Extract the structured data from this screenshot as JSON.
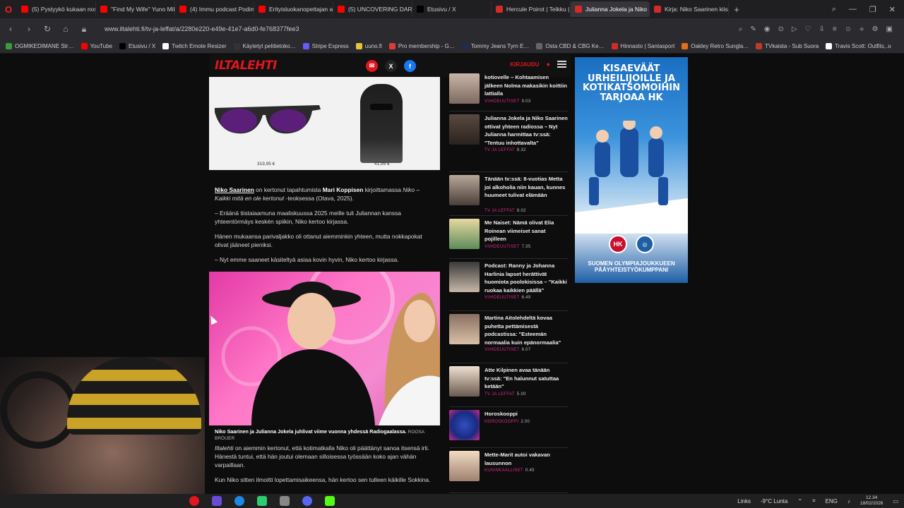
{
  "browser": {
    "tabs": [
      {
        "title": "(5) Pystyykö kukaan nostamaan…",
        "color": "#ff0000"
      },
      {
        "title": "\"Find My Wife\" Yuno Miles…",
        "color": "#ff0000"
      },
      {
        "title": "(4) Immu podcast Podimo…",
        "color": "#ff0000"
      },
      {
        "title": "Erityisluokanopettajan ar…",
        "color": "#ff0000"
      },
      {
        "title": "(5) UNCOVERING DARK E…",
        "color": "#ff0000"
      },
      {
        "title": "Etusivu / X",
        "color": "#000000"
      },
      {
        "title": "Hercule Poirot | Telkku | O…",
        "color": "#d42a2a"
      },
      {
        "title": "Julianna Jokela ja Niko Sa…",
        "color": "#d42a2a",
        "active": true
      },
      {
        "title": "Kirja: Niko Saarinen kiisti…",
        "color": "#d42a2a"
      }
    ],
    "url": "www.iltalehti.fi/tv-ja-leffat/a/2280e220-e49e-41e7-a6d0-fe768377fee3",
    "bookmarks": [
      {
        "label": "OGMIKEDIMANE Str…",
        "color": "#3a9c3a"
      },
      {
        "label": "YouTube",
        "color": "#ff0000"
      },
      {
        "label": "Etusivu / X",
        "color": "#000000"
      },
      {
        "label": "Twitch Emote Resizer",
        "color": "#ffffff"
      },
      {
        "label": "Käytetyt pelitietoko…",
        "color": "#333333"
      },
      {
        "label": "Stripe Express",
        "color": "#635bff"
      },
      {
        "label": "uuno.fi",
        "color": "#e8c23a"
      },
      {
        "label": "Pro membership - G…",
        "color": "#e03a3a"
      },
      {
        "label": "Tommy Jeans Tyrn E…",
        "color": "#1d2b55"
      },
      {
        "label": "Osta CBD & CBG Ke…",
        "color": "#666666"
      },
      {
        "label": "Hinnasto | Santasport",
        "color": "#d42a2a"
      },
      {
        "label": "Oakley Retro Sungla…",
        "color": "#e07020"
      },
      {
        "label": "TVkaista - Sub Suora",
        "color": "#c0392b"
      },
      {
        "label": "Travis Scott: Outfits,…",
        "color": "#ffffff"
      }
    ],
    "more_label": "»"
  },
  "site": {
    "logo": "ILTALEHTI",
    "login": "KIRJAUDU",
    "share_icons": [
      {
        "name": "email-share-icon",
        "glyph": "✉",
        "color": "#e1161f"
      },
      {
        "name": "x-share-icon",
        "glyph": "X",
        "color": "#222222"
      },
      {
        "name": "facebook-share-icon",
        "glyph": "f",
        "color": "#1877f2"
      }
    ]
  },
  "article": {
    "products": [
      {
        "price": "319,95 €"
      },
      {
        "price": "41,95 €"
      }
    ],
    "p1": {
      "name": "Niko Saarinen",
      "text_a": " on kertonut tapahtumista ",
      "author": "Mari Koppisen",
      "text_b": " kirjoittamassa ",
      "book": "Niko – Kaikki mitä en ole kertonut",
      "text_c": " -teoksessa (Otava, 2025)."
    },
    "p2": "– Eräänä tiistaiaamuna maaliskuussa 2025 meille tuli Juliannan kanssa yhteentörmäys keskén spiikin, Niko kertoo kirjassa.",
    "p3": "Hänen mukaansa parivaljakko oli ottanut aiemminkin yhteen, mutta nokkapokat olivat jääneet pieniksi.",
    "p4": "– Nyt emme saaneet käsiteltyä asiaa kovin hyvin, Niko kertoo kirjassa.",
    "caption": "Niko Saarinen ja Julianna Jokela juhlivat viime vuonna yhdessä Radiogaalassa.",
    "credit": "ROOSA BRÖIJER",
    "p5_italic": "Iltalehti",
    "p5": " on aiemmin kertonut, että kotimatkalla Niko oli päättänyt sanoa itsensä irti. Hänestä tuntui, että hän joutui olemaan silloisessa työssään koko ajan vähän varpaillaan.",
    "p6": "Kun Niko sitten ilmoitti lopettamisaikeensa, hän kertoo sen tulleen käikille Sokkina."
  },
  "news": [
    {
      "title": "kotiovelle – Kohtaamisen jälkeen Nolma makasikin koittiin lattialla",
      "section": "VIIHDEUUTISET",
      "time": "9.03"
    },
    {
      "title": "Julianna Jokela ja Niko Saarinen ottivat yhteen radiossa – Nyt Julianna harmittaa tv:ssä: \"Tentuu inhottavalta\"",
      "section": "TV JA LEFFAT",
      "time": "8.32"
    },
    {
      "title": "Tänään tv:ssä: 8-vuotias Metta joi alkoholia niin kauan, kunnes huumeet tulivat elämään",
      "section": "TV JA LEFFAT",
      "time": "8.02"
    },
    {
      "title": "Me Naiset: Nämä olivat Elia Roinean viimeiset sanat pojilleen",
      "section": "VIIHDEUUTISET",
      "time": "7.35"
    },
    {
      "title": "Podcast: Ranny ja Johanna Harlinia lapset herättivät huomiota poolokisissa – \"Kaikki ruokaa kaikkien päällä\"",
      "section": "VIIHDEUUTISET",
      "time": "6.49"
    },
    {
      "title": "Martina Aitolehdeltä kovaa puhetta pettämisestä podcastissa: \"Esteemän normaalia kuin epänormaalia\"",
      "section": "VIIHDEUUTISET",
      "time": "6.07"
    },
    {
      "title": "Atte Kilpinen avaa tänään tv:ssä: \"En halunnut satuttaa ketään\"",
      "section": "TV JA LEFFAT",
      "time": "5.00"
    },
    {
      "title": "Horoskooppi",
      "section": "HOROSKOOPPI",
      "time": "2.00"
    },
    {
      "title": "Mette-Marit autoi vakavan lausunnon",
      "section": "KUNINKAALLISET",
      "time": "0.45"
    }
  ],
  "ad": {
    "title": "KISAEVÄÄT URHEILIJOILLE JA KOTIKATSOMOIHIN TARJOAA HK",
    "brand": "HK",
    "footer": "SUOMEN OLYMPIAJOUKKUEEN PÄÄYHTEISTYÖKUMPPANI"
  },
  "taskbar": {
    "links": "Links",
    "weather": "-9°C  Lunta",
    "lang": "ENG",
    "time": "12.34",
    "date": "18/02/2026"
  }
}
